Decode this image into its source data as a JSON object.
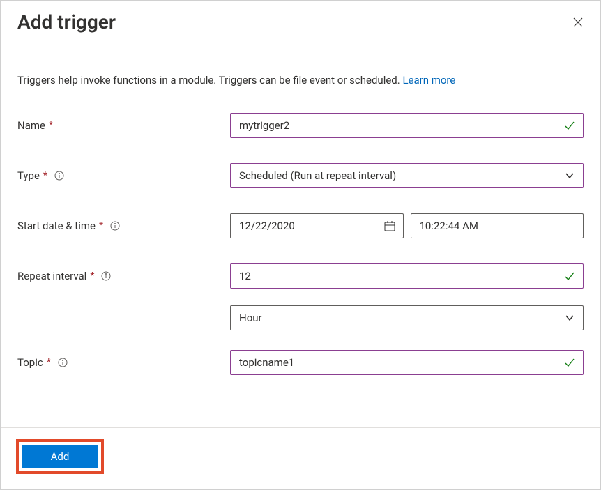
{
  "header": {
    "title": "Add trigger"
  },
  "description": {
    "text": "Triggers help invoke functions in a module. Triggers can be file event or scheduled. ",
    "learn_more": "Learn more"
  },
  "form": {
    "name": {
      "label": "Name",
      "value": "mytrigger2"
    },
    "type": {
      "label": "Type",
      "value": "Scheduled (Run at repeat interval)"
    },
    "start_date_time": {
      "label": "Start date & time",
      "date_value": "12/22/2020",
      "time_value": "10:22:44 AM"
    },
    "repeat_interval": {
      "label": "Repeat interval",
      "value": "12",
      "unit": "Hour"
    },
    "topic": {
      "label": "Topic",
      "value": "topicname1"
    }
  },
  "footer": {
    "add_label": "Add"
  }
}
